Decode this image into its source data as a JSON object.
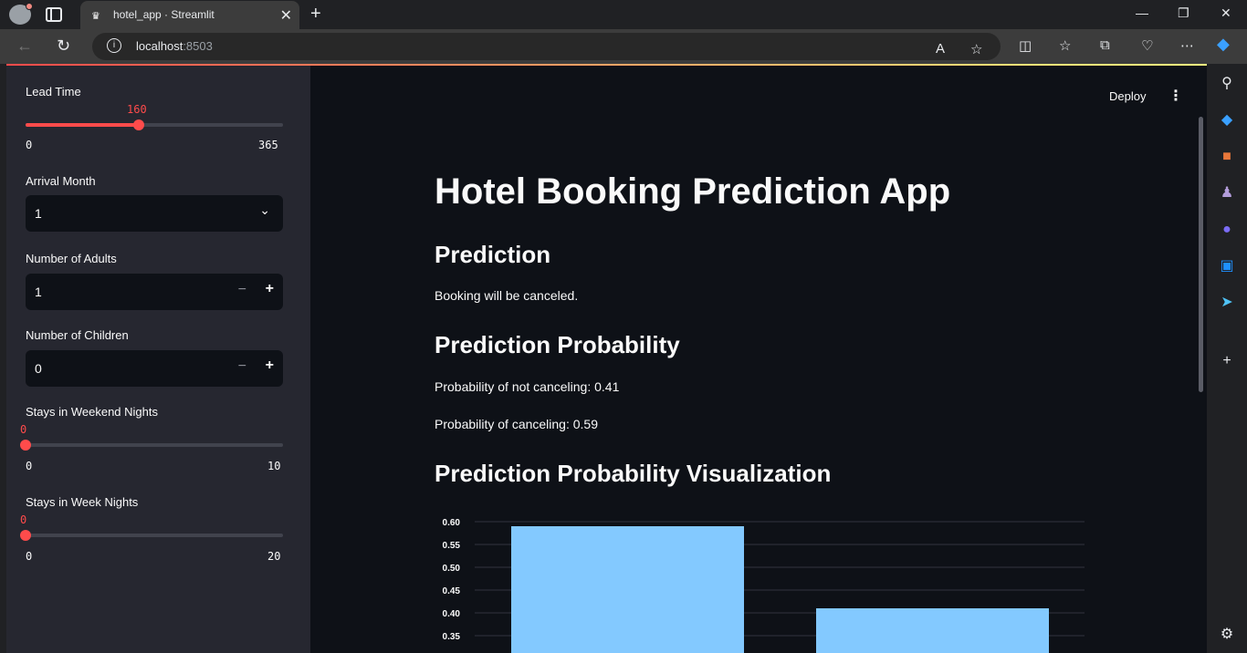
{
  "browser": {
    "tab_title": "hotel_app · Streamlit",
    "url_host": "localhost",
    "url_port": ":8503"
  },
  "sidebar": {
    "lead_time": {
      "label": "Lead Time",
      "value": "160",
      "min": "0",
      "max": "365",
      "fraction": 0.438
    },
    "arrival_month": {
      "label": "Arrival Month",
      "value": "1"
    },
    "adults": {
      "label": "Number of Adults",
      "value": "1"
    },
    "children": {
      "label": "Number of Children",
      "value": "0"
    },
    "weekend_nights": {
      "label": "Stays in Weekend Nights",
      "value": "0",
      "min": "0",
      "max": "10",
      "fraction": 0
    },
    "week_nights": {
      "label": "Stays in Week Nights",
      "value": "0",
      "min": "0",
      "max": "20",
      "fraction": 0
    }
  },
  "main": {
    "deploy_label": "Deploy",
    "title": "Hotel Booking Prediction App",
    "prediction_heading": "Prediction",
    "prediction_text": "Booking will be canceled.",
    "probability_heading": "Prediction Probability",
    "prob_not_cancel": "Probability of not canceling: 0.41",
    "prob_cancel": "Probability of canceling: 0.59",
    "viz_heading": "Prediction Probability Visualization"
  },
  "colors": {
    "accent": "#ff4b4b",
    "bar": "#83c9ff",
    "background": "#0e1117",
    "sidebar": "#262730"
  },
  "chart_data": {
    "type": "bar",
    "categories": [
      "",
      ""
    ],
    "values": [
      0.59,
      0.41
    ],
    "ylim_visible": [
      0.33,
      0.61
    ],
    "yticks": [
      "0.60",
      "0.55",
      "0.50",
      "0.45",
      "0.40",
      "0.35"
    ],
    "grid": true
  }
}
